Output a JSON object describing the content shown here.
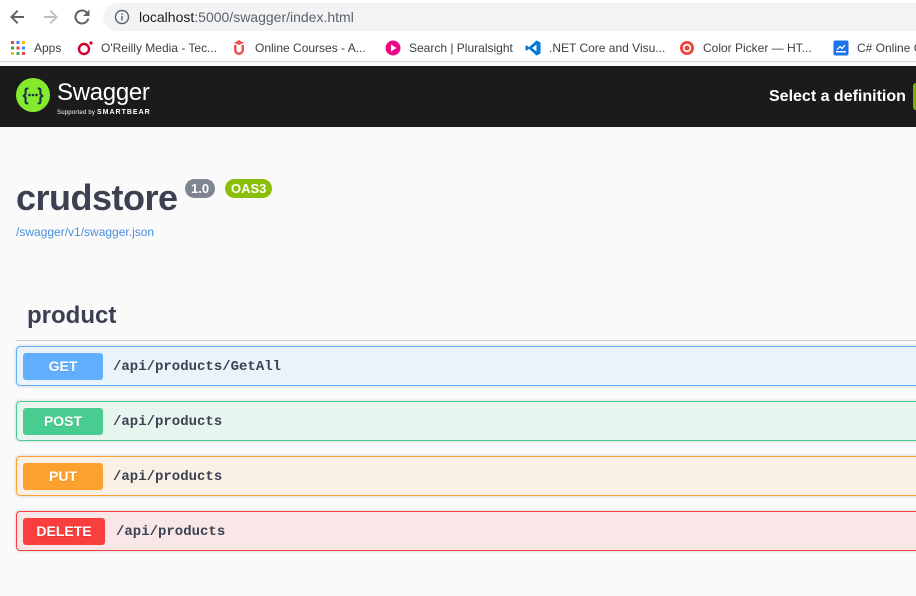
{
  "browser": {
    "url_host": "localhost",
    "url_rest": ":5000/swagger/index.html",
    "bookmarks": [
      {
        "label": "Apps",
        "icon": "apps-grid-icon",
        "color": "#4285f4"
      },
      {
        "label": "O'Reilly Media - Tec...",
        "icon": "oreilly-icon",
        "color": "#d3002d"
      },
      {
        "label": "Online Courses - A...",
        "icon": "udemy-icon",
        "color": "#ec5252"
      },
      {
        "label": "Search | Pluralsight",
        "icon": "pluralsight-icon",
        "color": "#f15b2a"
      },
      {
        "label": ".NET Core and Visu...",
        "icon": "vscode-icon",
        "color": "#0078d4"
      },
      {
        "label": "Color Picker — HT...",
        "icon": "color-picker-icon",
        "color": "#e8453c"
      },
      {
        "label": "C# Online C",
        "icon": "csharp-online-icon",
        "color": "#1a73e8"
      }
    ]
  },
  "topbar": {
    "brand": "Swagger",
    "supported_by": "Supported by",
    "smartbear": "SMARTBEAR",
    "select_definition": "Select a definition",
    "background": "#1b1b1b",
    "accent": "#85ea2d"
  },
  "info": {
    "title": "crudstore",
    "version": "1.0",
    "oas": "OAS3",
    "spec_url": "/swagger/v1/swagger.json"
  },
  "tag": {
    "name": "product",
    "operations": [
      {
        "method": "GET",
        "path": "/api/products/GetAll",
        "color": "#61affe"
      },
      {
        "method": "POST",
        "path": "/api/products",
        "color": "#49cc90"
      },
      {
        "method": "PUT",
        "path": "/api/products",
        "color": "#fca130"
      },
      {
        "method": "DELETE",
        "path": "/api/products",
        "color": "#f93e3e"
      }
    ]
  }
}
